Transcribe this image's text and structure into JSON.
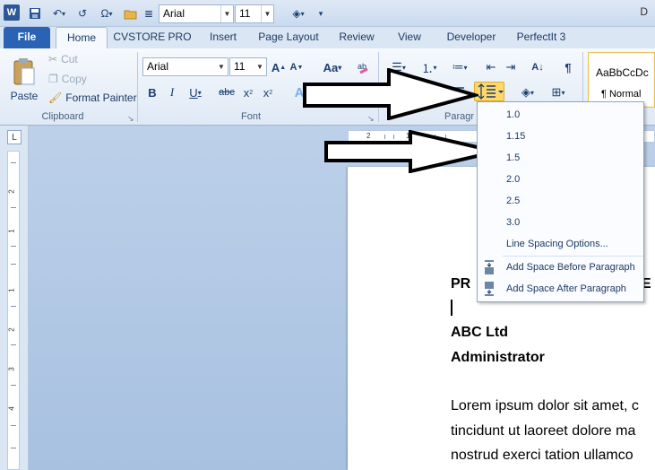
{
  "quick_access": {
    "app_icon": "W",
    "font_name": "Arial",
    "font_size": "11",
    "title_right": "D"
  },
  "tabs": [
    {
      "label": "File"
    },
    {
      "label": "Home"
    },
    {
      "label": "CVSTORE PRO"
    },
    {
      "label": "Insert"
    },
    {
      "label": "Page Layout"
    },
    {
      "label": "Review"
    },
    {
      "label": "View"
    },
    {
      "label": "Developer"
    },
    {
      "label": "PerfectIt 3"
    }
  ],
  "clipboard": {
    "paste": "Paste",
    "cut": "Cut",
    "copy": "Copy",
    "format_painter": "Format Painter",
    "group_label": "Clipboard"
  },
  "font": {
    "font_name": "Arial",
    "font_size": "11",
    "grow": "A",
    "shrink": "A",
    "case": "Aa",
    "bold": "B",
    "italic": "I",
    "underline": "U",
    "strike": "abc",
    "subscript": "x",
    "superscript": "x",
    "text_effects": "A",
    "highlight": "ab",
    "font_color": "A",
    "group_label": "Font"
  },
  "paragraph": {
    "group_label": "Paragr"
  },
  "styles": {
    "sample": "AaBbCcDc",
    "name": "¶ Normal"
  },
  "hruler_labels": [
    "2",
    "1",
    "1",
    "2"
  ],
  "vruler_labels": [
    "2",
    "1",
    "1",
    "2",
    "3",
    "4"
  ],
  "line_spacing_menu": {
    "options": [
      "1.0",
      "1.15",
      "1.5",
      "2.0",
      "2.5",
      "3.0"
    ],
    "line_spacing_options": "Line Spacing Options...",
    "add_before": "Add Space Before Paragraph",
    "add_after": "Add Space After Paragraph"
  },
  "document": {
    "heading_partial": "PR",
    "heading_partial_right": "E",
    "line1": "ABC Ltd",
    "line2": "Administrator",
    "body1": "Lorem ipsum dolor sit amet, c",
    "body2": "tincidunt ut laoreet dolore ma",
    "body3": "nostrud exerci tation ullamco"
  },
  "colors": {
    "accent_blue": "#2a62b4",
    "highlight_yellow": "#ffd86a",
    "font_red": "#e00000",
    "ribbon_bg": "#dfe9f5"
  }
}
